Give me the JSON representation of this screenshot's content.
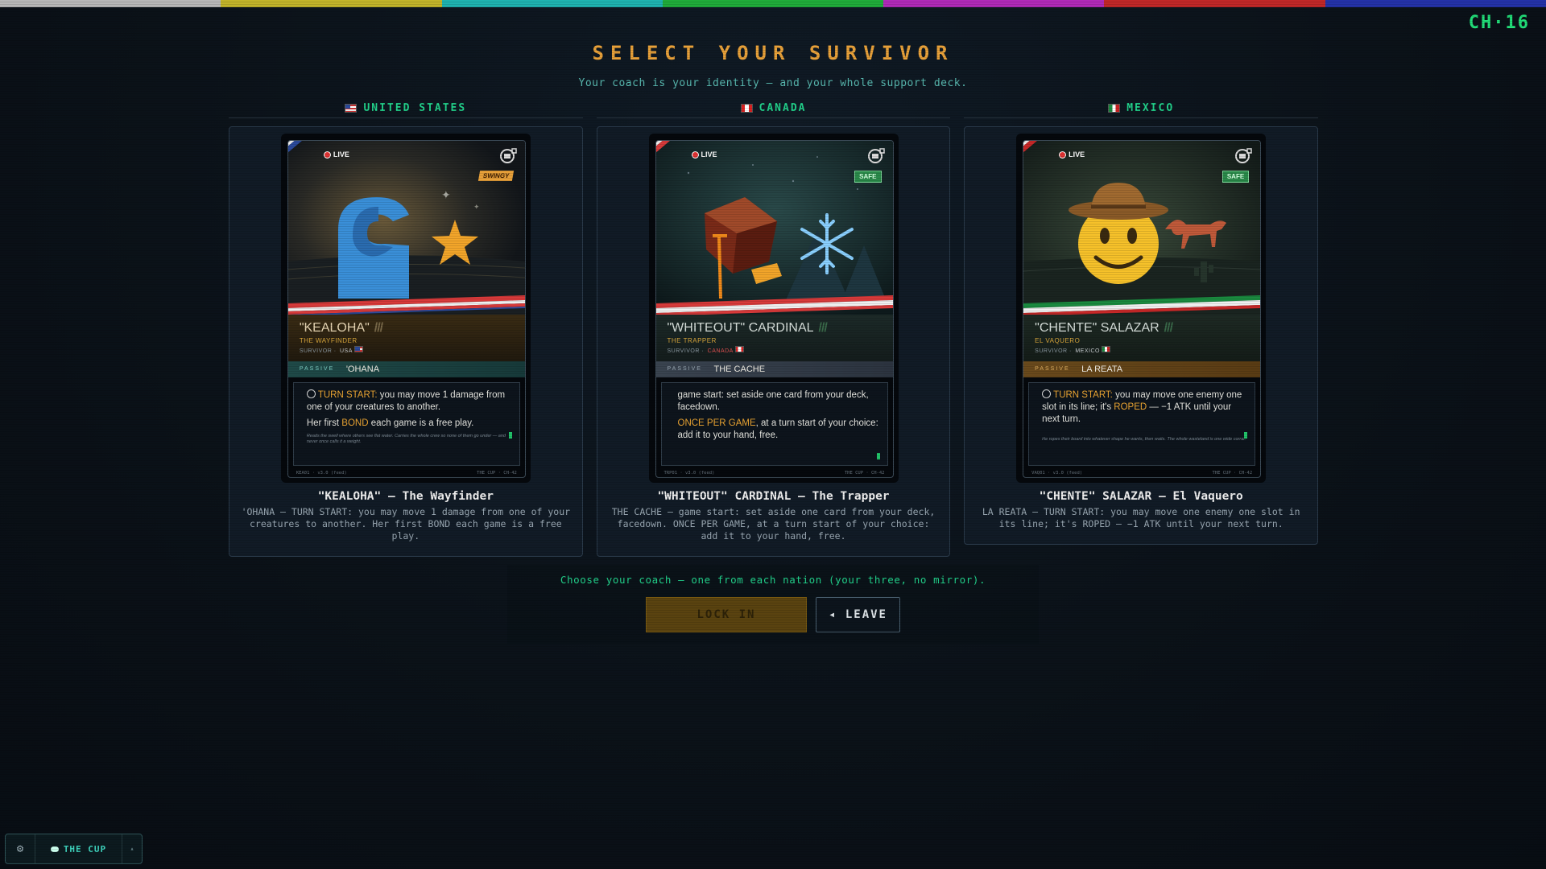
{
  "colorbar": [
    "#b8b8b8",
    "#c2b42a",
    "#1fb3b0",
    "#20ac3a",
    "#b12ab8",
    "#c12828",
    "#2432a8"
  ],
  "channel": "CH·16",
  "title": "SELECT YOUR SURVIVOR",
  "subtitle": "Your coach is your identity — and your whole support deck.",
  "survivors": [
    {
      "nation": "UNITED STATES",
      "live": "LIVE",
      "badge": "SWINGY",
      "name": "\"KEALOHA\"",
      "role": "THE WAYFINDER",
      "tag_prefix": "SURVIVOR ·",
      "tag_nation": "USA",
      "passive_label": "PASSIVE",
      "passive_name": "'OHANA",
      "text_1_kw": "TURN START:",
      "text_1": " you may move 1 damage from one of your creatures to another.",
      "text_2_pre": "Her first ",
      "text_2_kw": "BOND",
      "text_2_post": " each game is a free play.",
      "flavor": "Reads the swell where others see flat water. Carries the whole crew so none of them go under — and never once calls it a weight.",
      "footer_left": "KEA01 · v3.0 (feed)",
      "footer_right": "THE CUP · CH-42",
      "coach_title": "\"KEALOHA\" — The Wayfinder",
      "coach_desc": "'OHANA — TURN START: you may move 1 damage from one of your creatures to another. Her first BOND each game is a free play."
    },
    {
      "nation": "CANADA",
      "live": "LIVE",
      "badge": "SAFE",
      "name": "\"WHITEOUT\" CARDINAL",
      "role": "THE TRAPPER",
      "tag_prefix": "SURVIVOR ·",
      "tag_nation": "CANADA",
      "passive_label": "PASSIVE",
      "passive_name": "THE CACHE",
      "text_1_kw": "",
      "text_1": "game start: set aside one card from your deck, facedown.",
      "text_2_pre": "",
      "text_2_kw": "ONCE PER GAME",
      "text_2_post": ", at a turn start of your choice: add it to your hand, free.",
      "flavor": "",
      "footer_left": "TRP01 · v3.0 (feed)",
      "footer_right": "THE CUP · CH-42",
      "coach_title": "\"WHITEOUT\" CARDINAL — The Trapper",
      "coach_desc": "THE CACHE — game start: set aside one card from your deck, facedown. ONCE PER GAME, at a turn start of your choice: add it to your hand, free."
    },
    {
      "nation": "MEXICO",
      "live": "LIVE",
      "badge": "SAFE",
      "name": "\"CHENTE\" SALAZAR",
      "role": "EL VAQUERO",
      "tag_prefix": "SURVIVOR ·",
      "tag_nation": "MEXICO",
      "passive_label": "PASSIVE",
      "passive_name": "LA REATA",
      "text_1_kw": "TURN START:",
      "text_1": " you may move one enemy one slot in its line; it's ",
      "text_1_kw2": "ROPED",
      "text_1_post": " — −1 ATK until your next turn.",
      "flavor": "He ropes their board into whatever shape he wants, then waits. The whole wasteland is one wide corral.",
      "footer_left": "VAQ01 · v3.0 (feed)",
      "footer_right": "THE CUP · CH-42",
      "coach_title": "\"CHENTE\" SALAZAR — El Vaquero",
      "coach_desc": "LA REATA — TURN START: you may move one enemy one slot in its line; it's ROPED — −1 ATK until your next turn."
    }
  ],
  "choose_text": "Choose your coach — one from each nation (your three, no mirror).",
  "lock_in_label": "LOCK IN",
  "leave_label": "◂ LEAVE",
  "dock": {
    "gear_icon": "⚙",
    "cup_label": "THE CUP",
    "caret": "▴"
  }
}
